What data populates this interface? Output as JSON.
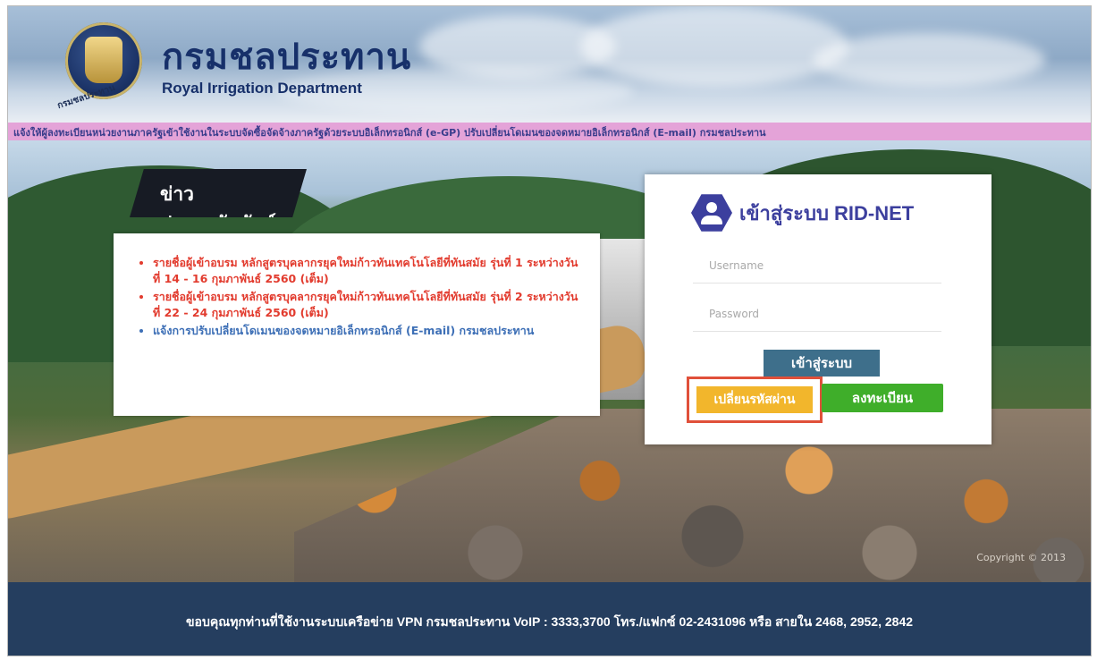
{
  "header": {
    "department_thai": "กรมชลประทาน",
    "department_english": "Royal Irrigation Department",
    "logo_caption": "กรมชลประทาน",
    "logo_icon": "royal-irrigation-seal"
  },
  "marquee": {
    "text": "แจ้งให้ผู้ลงทะเบียนหน่วยงานภาครัฐเข้าใช้งานในระบบจัดซื้อจัดจ้างภาครัฐด้วยระบบอิเล็กทรอนิกส์ (e-GP) ปรับเปลี่ยนโดเมนของจดหมายอิเล็กทรอนิกส์ (E-mail) กรมชลประทาน"
  },
  "news": {
    "heading": "ข่าวประชาสัมพันธ์",
    "items": [
      {
        "text": "รายชื่อผู้เข้าอบรม หลักสูตรบุคลากรยุคใหม่ก้าวทันเทคโนโลยีที่ทันสมัย รุ่นที่ 1 ระหว่างวันที่ 14 - 16 กุมภาพันธ์ 2560 (เต็ม)",
        "color": "#e23b2e"
      },
      {
        "text": "รายชื่อผู้เข้าอบรม หลักสูตรบุคลากรยุคใหม่ก้าวทันเทคโนโลยีที่ทันสมัย รุ่นที่ 2 ระหว่างวันที่ 22 - 24 กุมภาพันธ์ 2560 (เต็ม)",
        "color": "#e23b2e"
      },
      {
        "text": "แจ้งการปรับเปลี่ยนโดเมนของจดหมายอิเล็กทรอนิกส์ (E-mail) กรมชลประทาน",
        "color": "#3d6fb6"
      }
    ]
  },
  "login": {
    "title": "เข้าสู่ระบบ RID-NET",
    "icon": "user-hexagon-icon",
    "username_placeholder": "Username",
    "password_placeholder": "Password",
    "login_button": "เข้าสู่ระบบ",
    "reset_password_button": "เปลี่ยนรหัสผ่าน",
    "register_button": "ลงทะเบียน",
    "colors": {
      "title": "#3c3f9e",
      "login_button": "#3e6f8b",
      "reset_button": "#f2b62c",
      "register_button": "#3fae2a",
      "highlight_border": "#e0503a"
    }
  },
  "image_credit": "Copyright © 2013",
  "footer": {
    "text": "ขอบคุณทุกท่านที่ใช้งานระบบเครือข่าย VPN กรมชลประทาน VoIP : 3333,3700 โทร./แฟกซ์ 02-2431096 หรือ สายใน 2468, 2952, 2842"
  }
}
